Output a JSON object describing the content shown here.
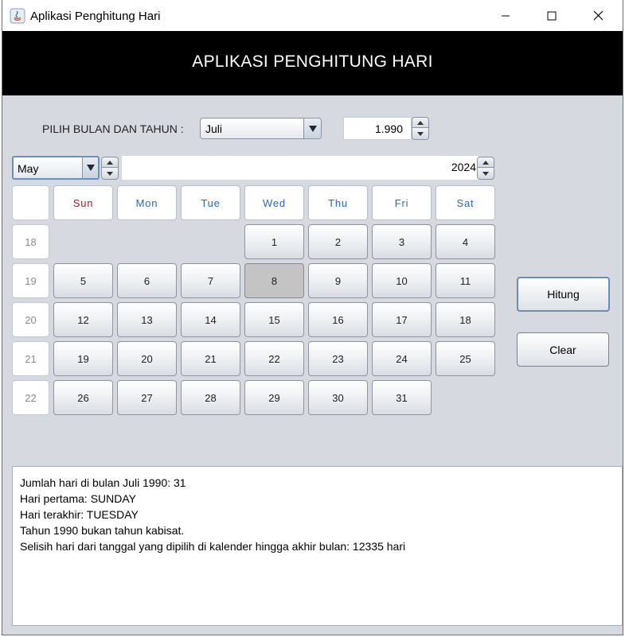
{
  "window": {
    "title": "Aplikasi Penghitung Hari",
    "controls": [
      "minimize",
      "maximize",
      "close"
    ]
  },
  "header": {
    "title": "APLIKASI PENGHITUNG HARI"
  },
  "form": {
    "label": "PILIH BULAN DAN TAHUN :",
    "month_value": "Juli",
    "year_value": "1.990"
  },
  "calendar": {
    "month_value": "May",
    "year_value": "2024",
    "day_headers": [
      "Sun",
      "Mon",
      "Tue",
      "Wed",
      "Thu",
      "Fri",
      "Sat"
    ],
    "weeks": [
      {
        "num": "18",
        "days": [
          "",
          "",
          "",
          "1",
          "2",
          "3",
          "4"
        ]
      },
      {
        "num": "19",
        "days": [
          "5",
          "6",
          "7",
          "8",
          "9",
          "10",
          "11"
        ]
      },
      {
        "num": "20",
        "days": [
          "12",
          "13",
          "14",
          "15",
          "16",
          "17",
          "18"
        ]
      },
      {
        "num": "21",
        "days": [
          "19",
          "20",
          "21",
          "22",
          "23",
          "24",
          "25"
        ]
      },
      {
        "num": "22",
        "days": [
          "26",
          "27",
          "28",
          "29",
          "30",
          "31",
          ""
        ]
      }
    ],
    "selected_day": "8"
  },
  "buttons": {
    "hitung": "Hitung",
    "clear": "Clear"
  },
  "output": {
    "lines": [
      "Jumlah hari di bulan Juli 1990: 31",
      "Hari pertama: SUNDAY",
      "Hari terakhir: TUESDAY",
      "Tahun 1990 bukan tahun kabisat.",
      "Selisih hari dari tanggal yang dipilih di kalender hingga akhir bulan: 12335 hari"
    ]
  },
  "colors": {
    "header_bg": "#000000",
    "panel_bg": "#d6d9df",
    "sunday": "#b01818",
    "weekday": "#2a66b5"
  }
}
